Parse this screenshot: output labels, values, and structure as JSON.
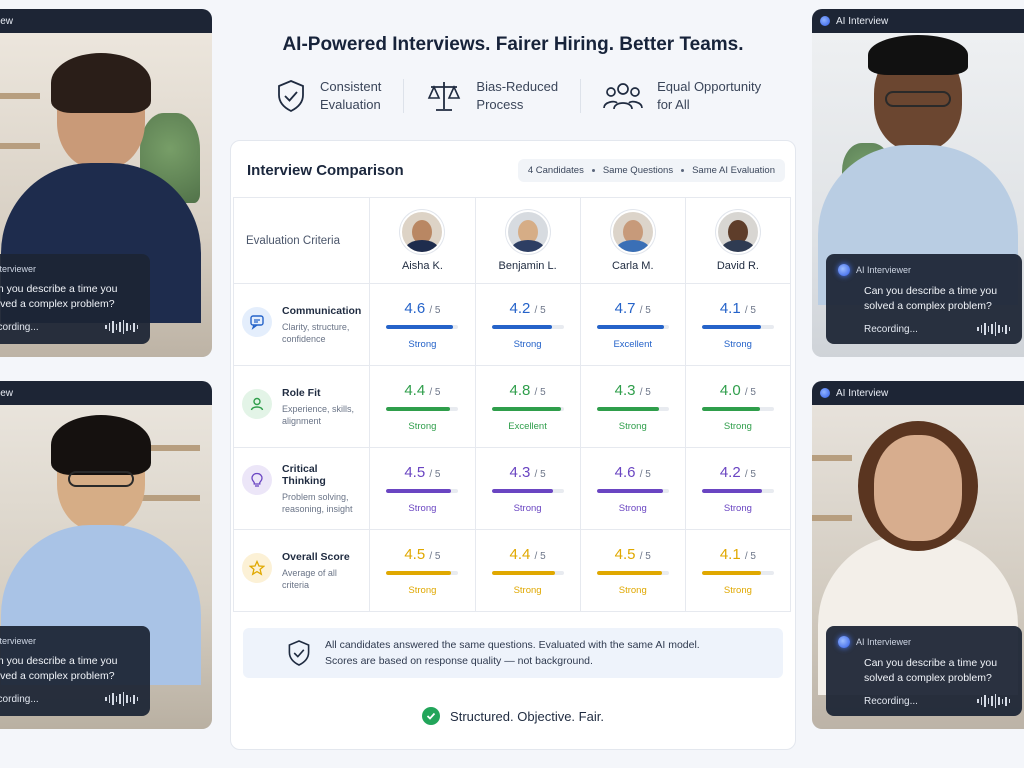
{
  "headline": "AI-Powered Interviews. Fairer Hiring. Better Teams.",
  "features": [
    {
      "icon": "shield-check-icon",
      "line1": "Consistent",
      "line2": "Evaluation"
    },
    {
      "icon": "scale-icon",
      "line1": "Bias-Reduced",
      "line2": "Process"
    },
    {
      "icon": "people-icon",
      "line1": "Equal Opportunity",
      "line2": "for All"
    }
  ],
  "panel": {
    "title": "Interview Comparison",
    "chips": [
      "4 Candidates",
      "Same Questions",
      "Same AI Evaluation"
    ],
    "criteria_header": "Evaluation Criteria",
    "candidates": [
      {
        "name": "Aisha K."
      },
      {
        "name": "Benjamin L."
      },
      {
        "name": "Carla M."
      },
      {
        "name": "David R."
      }
    ],
    "rows": [
      {
        "icon": "chat-icon",
        "color": "#2563c9",
        "bg": "#e4eefc",
        "title": "Communication",
        "desc1": "Clarity, structure,",
        "desc2": "confidence",
        "scores": [
          {
            "v": "4.6",
            "l": "Strong",
            "f": 0.92
          },
          {
            "v": "4.2",
            "l": "Strong",
            "f": 0.84
          },
          {
            "v": "4.7",
            "l": "Excellent",
            "f": 0.94
          },
          {
            "v": "4.1",
            "l": "Strong",
            "f": 0.82
          }
        ]
      },
      {
        "icon": "user-icon",
        "color": "#2f9e4b",
        "bg": "#e3f4e7",
        "title": "Role Fit",
        "desc1": "Experience, skills,",
        "desc2": "alignment",
        "scores": [
          {
            "v": "4.4",
            "l": "Strong",
            "f": 0.88
          },
          {
            "v": "4.8",
            "l": "Excellent",
            "f": 0.96
          },
          {
            "v": "4.3",
            "l": "Strong",
            "f": 0.86
          },
          {
            "v": "4.0",
            "l": "Strong",
            "f": 0.8
          }
        ]
      },
      {
        "icon": "lightbulb-icon",
        "color": "#6a45c2",
        "bg": "#ece6f8",
        "title": "Critical Thinking",
        "desc1": "Problem solving,",
        "desc2": "reasoning, insight",
        "scores": [
          {
            "v": "4.5",
            "l": "Strong",
            "f": 0.9
          },
          {
            "v": "4.3",
            "l": "Strong",
            "f": 0.86
          },
          {
            "v": "4.6",
            "l": "Strong",
            "f": 0.92
          },
          {
            "v": "4.2",
            "l": "Strong",
            "f": 0.84
          }
        ]
      },
      {
        "icon": "star-icon",
        "color": "#e0a800",
        "bg": "#fcf1d6",
        "title": "Overall Score",
        "desc1": "Average of all",
        "desc2": "criteria",
        "scores": [
          {
            "v": "4.5",
            "l": "Strong",
            "f": 0.9
          },
          {
            "v": "4.4",
            "l": "Strong",
            "f": 0.88
          },
          {
            "v": "4.5",
            "l": "Strong",
            "f": 0.9
          },
          {
            "v": "4.1",
            "l": "Strong",
            "f": 0.82
          }
        ]
      }
    ],
    "out_of": "/ 5",
    "note_line1": "All candidates answered the same questions. Evaluated with the same AI model.",
    "note_line2": "Scores are based on response quality — not background.",
    "footer": "Structured. Objective. Fair."
  },
  "tiles": {
    "left_top": {
      "bar": "iew",
      "title": "Interviewer",
      "q1": "an you describe a time you",
      "q2": "olved a complex problem?",
      "rec": "ecording..."
    },
    "left_bottom": {
      "bar": "iew",
      "title": "Interviewer",
      "q1": "an you describe a time you",
      "q2": "olved a complex problem?",
      "rec": "ecording..."
    },
    "right_top": {
      "bar": "AI Interview",
      "title": "AI Interviewer",
      "q1": "Can you describe a time you",
      "q2": "solved a complex problem?",
      "rec": "Recording..."
    },
    "right_bottom": {
      "bar": "AI Interview",
      "title": "AI Interviewer",
      "q1": "Can you describe a time you",
      "q2": "solved a complex problem?",
      "rec": "Recording..."
    }
  }
}
